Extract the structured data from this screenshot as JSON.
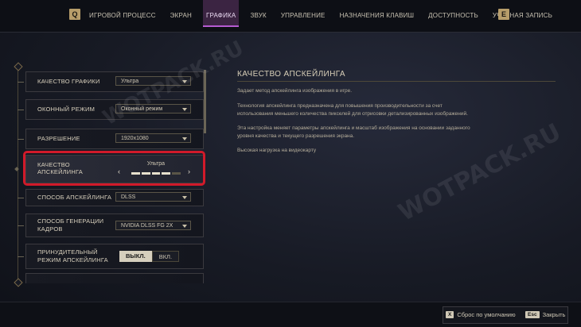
{
  "nav": {
    "left_key": "Q",
    "right_key": "E",
    "tabs": [
      {
        "label": "ИГРОВОЙ ПРОЦЕСС",
        "active": false
      },
      {
        "label": "ЭКРАН",
        "active": false
      },
      {
        "label": "ГРАФИКА",
        "active": true
      },
      {
        "label": "ЗВУК",
        "active": false
      },
      {
        "label": "УПРАВЛЕНИЕ",
        "active": false
      },
      {
        "label": "НАЗНАЧЕНИЯ КЛАВИШ",
        "active": false
      },
      {
        "label": "ДОСТУПНОСТЬ",
        "active": false
      },
      {
        "label": "УЧЕТНАЯ ЗАПИСЬ",
        "active": false
      }
    ]
  },
  "settings": {
    "graphics_quality": {
      "label": "КАЧЕСТВО ГРАФИКИ",
      "value": "Ультра"
    },
    "window_mode": {
      "label": "ОКОННЫЙ РЕЖИМ",
      "value": "Оконный режим"
    },
    "resolution": {
      "label": "РАЗРЕШЕНИЕ",
      "value": "1920x1080"
    },
    "upscaling_quality": {
      "label_line1": "КАЧЕСТВО",
      "label_line2": "АПСКЕЙЛИНГА",
      "value": "Ультра",
      "level": 4,
      "levels": 5
    },
    "upscaling_method": {
      "label": "СПОСОБ АПСКЕЙЛИНГА",
      "value": "DLSS"
    },
    "frame_generation": {
      "label_line1": "СПОСОБ ГЕНЕРАЦИИ",
      "label_line2": "КАДРОВ",
      "value": "NVIDIA DLSS FG 2X"
    },
    "forced_upscaling": {
      "label_line1": "ПРИНУДИТЕЛЬНЫЙ",
      "label_line2": "РЕЖИМ АПСКЕЙЛИНГА",
      "off": "ВЫКЛ.",
      "on": "ВКЛ.",
      "selected": "off"
    }
  },
  "description": {
    "title": "КАЧЕСТВО АПСКЕЙЛИНГА",
    "p1": "Задает метод апскейлинга изображения в игре.",
    "p2": "Технология апскейлинга предназначена для повышения производительности за счет использования меньшего количества пикселей для отрисовки детализированных изображений.",
    "p3": "Эта настройка меняет параметры апскейлинга и масштаб изображения на основании заданного уровня качества и текущего разрешения экрана.",
    "p4": "Высокая нагрузка на видеокарту"
  },
  "watermark": "WOTPACK.RU",
  "footer": {
    "reset_key": "X",
    "reset_label": "Сброс по умолчанию",
    "close_key": "Esc",
    "close_label": "Закрыть"
  },
  "colors": {
    "accent_purple": "#b65bd1",
    "highlight_red": "#d11a2a",
    "gold": "#b79d6a"
  }
}
